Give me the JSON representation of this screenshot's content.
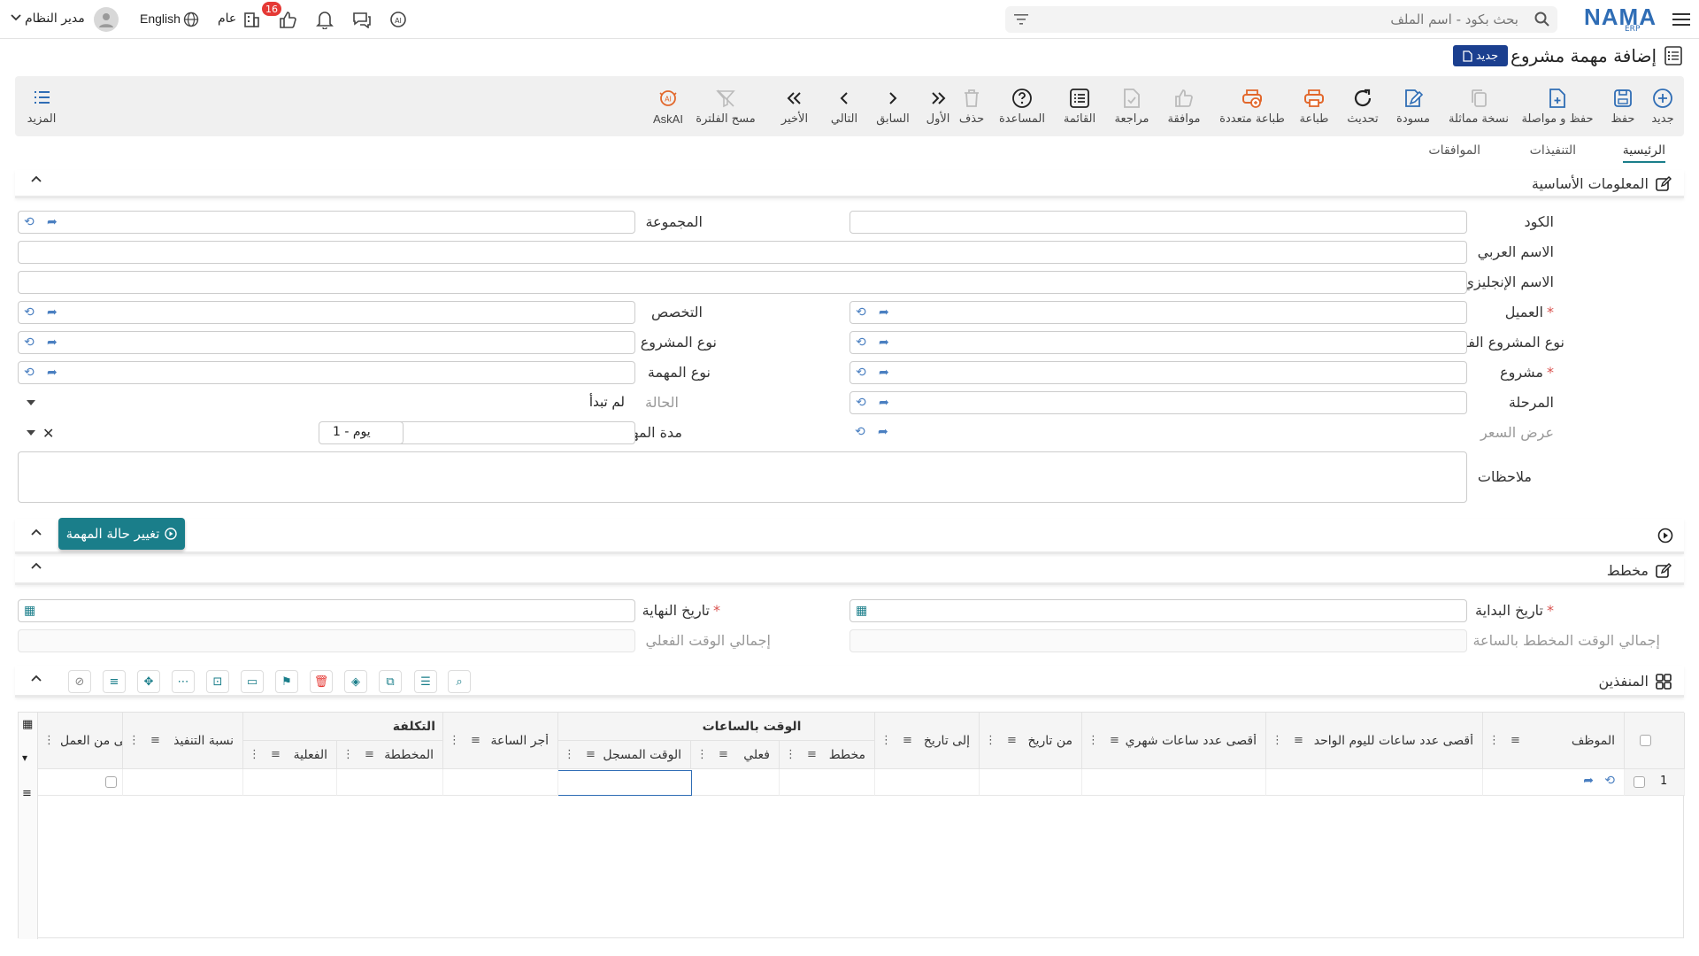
{
  "topbar": {
    "brand": "NAMA",
    "brand_sub": "ERP",
    "search_placeholder": "بحث بكود - اسم الملف",
    "language": "English",
    "general": "عام",
    "notification_count": "16",
    "user_name": "مدير النظام"
  },
  "page": {
    "title": "إضافة مهمة مشروع",
    "badge": "جديد"
  },
  "toolbar": [
    {
      "label": "جديد",
      "icon": "plus-circle-icon",
      "color": "#2f6db5"
    },
    {
      "label": "حفظ",
      "icon": "save-icon",
      "color": "#2f6db5"
    },
    {
      "label": "حفظ و مواصلة",
      "icon": "file-plus-icon",
      "color": "#2f6db5"
    },
    {
      "label": "نسخة مماثلة",
      "icon": "copy-icon",
      "color": "#bbbbbb"
    },
    {
      "label": "مسودة",
      "icon": "draft-edit-icon",
      "color": "#2f6db5"
    },
    {
      "label": "تحديث",
      "icon": "refresh-icon",
      "color": "#222222"
    },
    {
      "label": "طباعة",
      "icon": "print-icon",
      "color": "#e2672b"
    },
    {
      "label": "طباعة متعددة",
      "icon": "multi-print-icon",
      "color": "#e2672b"
    },
    {
      "label": "موافقة",
      "icon": "thumbs-up-icon",
      "color": "#bbbbbb"
    },
    {
      "label": "مراجعة",
      "icon": "review-doc-icon",
      "color": "#bbbbbb"
    },
    {
      "label": "القائمة",
      "icon": "list-icon",
      "color": "#222222"
    },
    {
      "label": "المساعدة",
      "icon": "help-icon",
      "color": "#222222"
    },
    {
      "label": "حذف",
      "icon": "trash-icon",
      "color": "#bbbbbb"
    },
    {
      "label": "الأول",
      "icon": "first-icon",
      "color": "#222222"
    },
    {
      "label": "السابق",
      "icon": "previous-icon",
      "color": "#222222"
    },
    {
      "label": "التالي",
      "icon": "next-icon",
      "color": "#222222"
    },
    {
      "label": "الأخير",
      "icon": "last-icon",
      "color": "#222222"
    },
    {
      "label": "مسح الفلترة",
      "icon": "clear-filter-icon",
      "color": "#bbbbbb"
    },
    {
      "label": "AskAI",
      "icon": "ask-ai-icon",
      "color": "#e2672b"
    }
  ],
  "more_label": "المزيد",
  "tabs": [
    "الرئيسية",
    "التنفيذات",
    "الموافقات"
  ],
  "sections": {
    "basic": "المعلومات الأساسية",
    "plan": "مخطط",
    "executors": "المنفذين"
  },
  "fields": {
    "code": "الكود",
    "group": "المجموعة",
    "arabic_name": "الاسم العربي",
    "english_name": "الاسم الإنجليزي",
    "customer": "العميل",
    "specialization": "التخصص",
    "sub_project_type": "نوع المشروع الفرعى",
    "project_type": "نوع المشروع",
    "project": "مشروع",
    "task_type": "نوع المهمة",
    "phase": "المرحلة",
    "status": "الحالة",
    "status_value": "لم تبدأ",
    "price_offer": "عرض السعر",
    "task_duration": "مدة المهمة",
    "duration_value": "1 - يوم",
    "notes": "ملاحظات"
  },
  "change_status_button": "تغيير حالة المهمة",
  "plan": {
    "start_date": "تاريخ البداية",
    "end_date": "تاريخ النهاية",
    "total_planned": "إجمالي الوقت المخطط بالساعة",
    "total_actual": "إجمالي الوقت الفعلي"
  },
  "grid": {
    "group_hours": "الوقت بالساعات",
    "group_cost": "التكلفة",
    "columns": {
      "employee": "الموظف",
      "max_daily": "أقصى عدد ساعات لليوم الواحد",
      "max_monthly": "أقصى عدد ساعات شهري",
      "from_date": "من تاريخ",
      "to_date": "إلى تاريخ",
      "planned": "مخطط",
      "actual": "فعلي",
      "logged": "الوقت المسجل",
      "hour_rate": "أجر الساعة",
      "cost_planned": "المخططة",
      "cost_actual": "الفعلية",
      "exec_ratio": "نسبة التنفيذ",
      "finished": "إنتهى من العمل"
    },
    "rows": [
      {
        "num": "1"
      }
    ]
  },
  "colors": {
    "accent": "#1a7e8a",
    "brand": "#2f6db5",
    "required": "#d9534f"
  }
}
